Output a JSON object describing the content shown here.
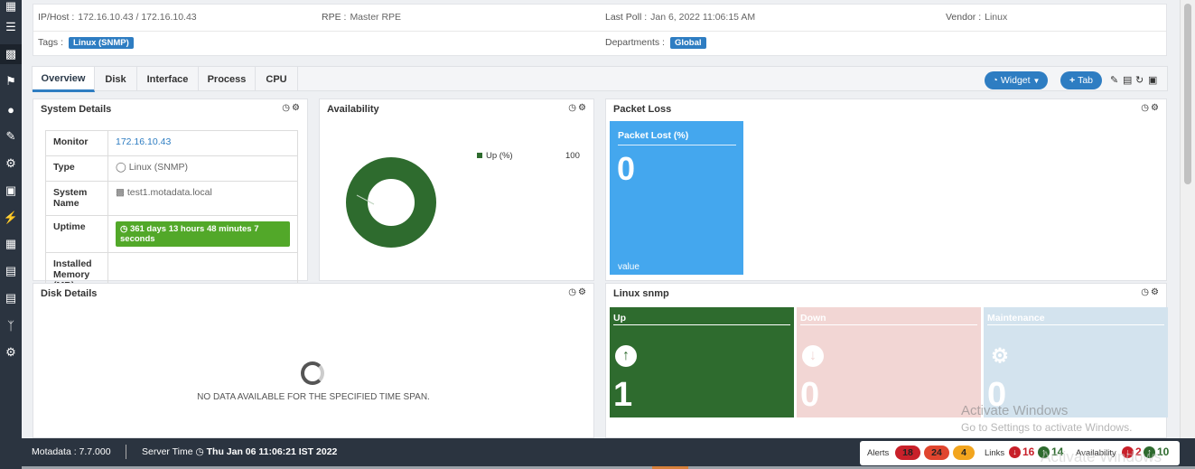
{
  "info": {
    "ip_label": "IP/Host :",
    "ip_value": "172.16.10.43 / 172.16.10.43",
    "rpe_label": "RPE :",
    "rpe_value": "Master RPE",
    "poll_label": "Last Poll :",
    "poll_value": "Jan 6, 2022 11:06:15 AM",
    "vendor_label": "Vendor :",
    "vendor_value": "Linux",
    "tags_label": "Tags :",
    "tags_value": "Linux (SNMP)",
    "departments_label": "Departments :",
    "departments_value": "Global"
  },
  "tabs": [
    "Overview",
    "Disk",
    "Interface",
    "Process",
    "CPU"
  ],
  "toolbar": {
    "widget_label": "Widget",
    "tab_label": "Tab"
  },
  "system_details": {
    "title": "System Details",
    "rows": {
      "monitor": {
        "label": "Monitor",
        "value": "172.16.10.43"
      },
      "type": {
        "label": "Type",
        "value": "Linux (SNMP)"
      },
      "system_name": {
        "label": "System Name",
        "value": "test1.motadata.local"
      },
      "uptime": {
        "label": "Uptime",
        "value": "361 days 13 hours 48 minutes 7 seconds"
      },
      "memory": {
        "label": "Installed Memory (MB)",
        "value": ""
      }
    }
  },
  "availability": {
    "title": "Availability",
    "legend_label": "Up (%)",
    "legend_value": "100",
    "up_percent": 100,
    "color": "#2e6b2e"
  },
  "packet_loss": {
    "title": "Packet Loss",
    "tile_title": "Packet Lost (%)",
    "value": "0",
    "footer": "value",
    "color": "#44a7ee"
  },
  "disk_details": {
    "title": "Disk Details",
    "no_data": "NO DATA AVAILABLE FOR THE SPECIFIED TIME SPAN."
  },
  "linux_snmp": {
    "title": "Linux snmp",
    "tiles": [
      {
        "label": "Up",
        "count": "1",
        "color": "#2e6b2e"
      },
      {
        "label": "Down",
        "count": "0",
        "color": "#f2d6d4"
      },
      {
        "label": "Maintenance",
        "count": "0",
        "color": "#d3e3ee"
      }
    ]
  },
  "watermark": {
    "line1": "Activate Windows",
    "line2": "Go to Settings to activate Windows.",
    "line3": "Activate Windows"
  },
  "footer": {
    "version": "Motadata : 7.7.000",
    "server_time_label": "Server Time",
    "server_time_value": "Thu Jan 06 11:06:21 IST 2022",
    "alerts_label": "Alerts",
    "alerts": [
      "18",
      "24",
      "4"
    ],
    "links_label": "Links",
    "links_down": "16",
    "links_up": "14",
    "availability_label": "Availability",
    "avail_down": "2",
    "avail_up": "10"
  }
}
